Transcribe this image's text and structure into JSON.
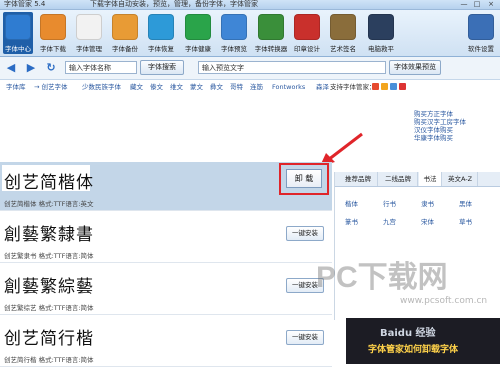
{
  "window": {
    "title": "字体管家 5.4",
    "subtitle": "下载字体自动安装，预览，管理，备份字体，字体管家",
    "controls": [
      "—",
      "□",
      "×"
    ]
  },
  "toolbar": [
    {
      "label": "字体中心",
      "icon": "house-icon",
      "color": "#2f7cd1",
      "active": true
    },
    {
      "label": "字体下载",
      "icon": "download-folder-icon",
      "color": "#e88b2e"
    },
    {
      "label": "字体管理",
      "icon": "font-manage-icon",
      "color": "#f2f2f2"
    },
    {
      "label": "字体备份",
      "icon": "backup-folder-icon",
      "color": "#e89b35"
    },
    {
      "label": "字体恢复",
      "icon": "restore-icon",
      "color": "#2d9ad8"
    },
    {
      "label": "字体健康",
      "icon": "health-cross-icon",
      "color": "#2aa44a"
    },
    {
      "label": "字体预览",
      "icon": "preview-window-icon",
      "color": "#3f86d6"
    },
    {
      "label": "字体转换器",
      "icon": "converter-icon",
      "color": "#3a8f3a"
    },
    {
      "label": "印章设计",
      "icon": "seal-icon",
      "color": "#c9302c"
    },
    {
      "label": "艺术签名",
      "icon": "signature-icon",
      "color": "#8a6d3b"
    },
    {
      "label": "电脑救平",
      "icon": "computer-icon",
      "color": "#2b3f5e"
    },
    {
      "label": "软件设置",
      "icon": "gear-icon",
      "color": "#3b6fb6"
    }
  ],
  "nav": {
    "search_placeholder": "输入字体名称",
    "search_button": "字体搜索",
    "preview_placeholder": "输入预览文字",
    "preview_button": "字体效果预览"
  },
  "categories": [
    "字体库",
    "→ 创艺字体",
    "少数民族字体",
    "藏文",
    "傣文",
    "维文",
    "蒙文",
    "彝文",
    "哥特",
    "连筋",
    "Fontworks",
    "森泽"
  ],
  "support_label": "支持字体管家：",
  "ad_links": [
    "购买方正字体",
    "购买汉字工房字体",
    "汉仪字体购买",
    "华康字体购买"
  ],
  "fonts": [
    {
      "name": "创艺简楷体",
      "meta": "创艺简楷体  格式:TTF语言:英文",
      "action": "卸 载",
      "selected": true
    },
    {
      "name": "創藝繁隸書",
      "meta": "创艺繁隶书  格式:TTF语言:简体",
      "action": "一键安装",
      "selected": false
    },
    {
      "name": "創藝繁綜藝",
      "meta": "创艺繁综艺  格式:TTF语言:简体",
      "action": "一键安装",
      "selected": false
    },
    {
      "name": "创艺简行楷",
      "meta": "创艺简行楷  格式:TTF语言:简体",
      "action": "一键安装",
      "selected": false
    }
  ],
  "right_panel": {
    "tabs": [
      "推荐品牌",
      "二线品牌",
      "书法",
      "英文A-Z"
    ],
    "grid": [
      "楷体",
      "行书",
      "隶书",
      "黑体",
      "篆书",
      "九宫",
      "宋体",
      "草书"
    ]
  },
  "thumbnail": {
    "line1": "Baidu 经验",
    "line2": "字体管家如何卸载字体"
  },
  "watermark": {
    "brand": "PC下载网",
    "url": "www.pcsoft.com.cn"
  }
}
